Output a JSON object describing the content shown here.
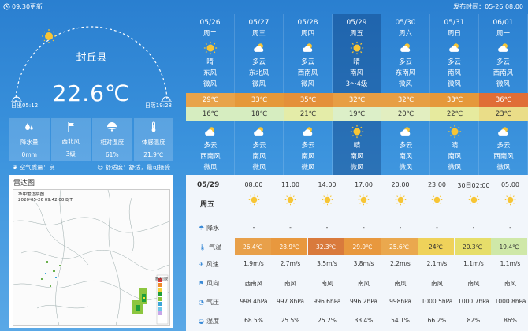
{
  "header": {
    "update_time": "09:30更新",
    "publish_label": "发布时间：05-26 08:00"
  },
  "today": {
    "city": "封丘县",
    "temperature": "22.6℃",
    "sunrise": "日出05:12",
    "sunset": "日落19:28",
    "stats": [
      {
        "icon": "rain-drop-icon",
        "label": "降水量",
        "value": "0mm"
      },
      {
        "icon": "wind-flag-icon",
        "label": "西北风",
        "value": "3级"
      },
      {
        "icon": "humidity-icon",
        "label": "相对湿度",
        "value": "61%"
      },
      {
        "icon": "thermometer-icon",
        "label": "体感温度",
        "value": "21.9℃"
      }
    ],
    "air_quality": "空气质量：良",
    "comfort": "舒适度：舒适，最可接受"
  },
  "radar": {
    "title": "雷达图",
    "map_caption": "华中雷达拼图",
    "map_time": "2020-05-26 09:42:00 BJT",
    "legend_title": "雷达回波"
  },
  "forecast": [
    {
      "date": "05/26",
      "week": "周二",
      "day_weather": "晴",
      "day_wind_dir": "东风",
      "day_wind_level": "微风",
      "high": "29℃",
      "low": "16℃",
      "night_weather": "多云",
      "night_wind_dir": "西南风",
      "night_wind_level": "微风",
      "high_color": "#e8a34a",
      "low_color": "#d6edc0",
      "day_icon": "sun-icon",
      "night_icon": "partly-cloudy-icon"
    },
    {
      "date": "05/27",
      "week": "周三",
      "day_weather": "多云",
      "day_wind_dir": "东北风",
      "day_wind_level": "微风",
      "high": "33℃",
      "low": "18℃",
      "night_weather": "多云",
      "night_wind_dir": "南风",
      "night_wind_level": "微风",
      "high_color": "#e5983a",
      "low_color": "#d6edc0",
      "day_icon": "partly-cloudy-icon",
      "night_icon": "partly-cloudy-icon"
    },
    {
      "date": "05/28",
      "week": "周四",
      "day_weather": "多云",
      "day_wind_dir": "西南风",
      "day_wind_level": "微风",
      "high": "35℃",
      "low": "21℃",
      "night_weather": "多云",
      "night_wind_dir": "南风",
      "night_wind_level": "微风",
      "high_color": "#e4903a",
      "low_color": "#e4eca8",
      "day_icon": "partly-cloudy-icon",
      "night_icon": "partly-cloudy-icon"
    },
    {
      "date": "05/29",
      "week": "周五",
      "day_weather": "晴",
      "day_wind_dir": "南风",
      "day_wind_level": "3～4级",
      "high": "32℃",
      "low": "19℃",
      "night_weather": "晴",
      "night_wind_dir": "南风",
      "night_wind_level": "微风",
      "high_color": "#e79e44",
      "low_color": "#dcefc8",
      "day_icon": "sun-icon",
      "night_icon": "sun-icon"
    },
    {
      "date": "05/30",
      "week": "周六",
      "day_weather": "多云",
      "day_wind_dir": "东南风",
      "day_wind_level": "微风",
      "high": "32℃",
      "low": "20℃",
      "night_weather": "多云",
      "night_wind_dir": "南风",
      "night_wind_level": "微风",
      "high_color": "#e79e44",
      "low_color": "#e2eec0",
      "day_icon": "partly-cloudy-icon",
      "night_icon": "partly-cloudy-icon"
    },
    {
      "date": "05/31",
      "week": "周日",
      "day_weather": "多云",
      "day_wind_dir": "南风",
      "day_wind_level": "微风",
      "high": "33℃",
      "low": "22℃",
      "night_weather": "晴",
      "night_wind_dir": "南风",
      "night_wind_level": "微风",
      "high_color": "#e5983a",
      "low_color": "#e6ea9e",
      "day_icon": "partly-cloudy-icon",
      "night_icon": "sun-icon"
    },
    {
      "date": "06/01",
      "week": "周一",
      "day_weather": "多云",
      "day_wind_dir": "西南风",
      "day_wind_level": "微风",
      "high": "36℃",
      "low": "23℃",
      "night_weather": "多云",
      "night_wind_dir": "西南风",
      "night_wind_level": "微风",
      "high_color": "#e06e36",
      "low_color": "#eadd88",
      "day_icon": "partly-cloudy-icon",
      "night_icon": "partly-cloudy-icon"
    }
  ],
  "hourly": {
    "date": "05/29",
    "week": "周五",
    "labels": {
      "precip": "降水",
      "temp": "气温",
      "wind_speed": "风速",
      "wind_dir": "风向",
      "pressure": "气压",
      "humidity": "湿度"
    },
    "times": [
      "08:00",
      "11:00",
      "14:00",
      "17:00",
      "20:00",
      "23:00",
      "30日02:00",
      "05:00"
    ],
    "precip": [
      "-",
      "-",
      "-",
      "-",
      "-",
      "-",
      "-",
      "-"
    ],
    "temps": [
      "26.4℃",
      "28.9℃",
      "32.3℃",
      "29.9℃",
      "25.6℃",
      "24℃",
      "20.3℃",
      "19.4℃"
    ],
    "temp_colors": [
      "#e8a04a",
      "#e8983e",
      "#d97a3c",
      "#e8983e",
      "#eaa84e",
      "#efd25a",
      "#e6de6a",
      "#cfe8a8"
    ],
    "wind_speed": [
      "1.9m/s",
      "2.7m/s",
      "3.5m/s",
      "3.8m/s",
      "2.2m/s",
      "2.1m/s",
      "1.1m/s",
      "1.1m/s"
    ],
    "wind_dir": [
      "西南风",
      "南风",
      "南风",
      "南风",
      "南风",
      "南风",
      "南风",
      "南风"
    ],
    "pressure": [
      "998.4hPa",
      "997.8hPa",
      "996.6hPa",
      "996.2hPa",
      "998hPa",
      "1000.5hPa",
      "1000.7hPa",
      "1000.8hPa"
    ],
    "humidity": [
      "68.5%",
      "25.5%",
      "25.2%",
      "33.4%",
      "54.1%",
      "66.2%",
      "82%",
      "86%"
    ]
  }
}
